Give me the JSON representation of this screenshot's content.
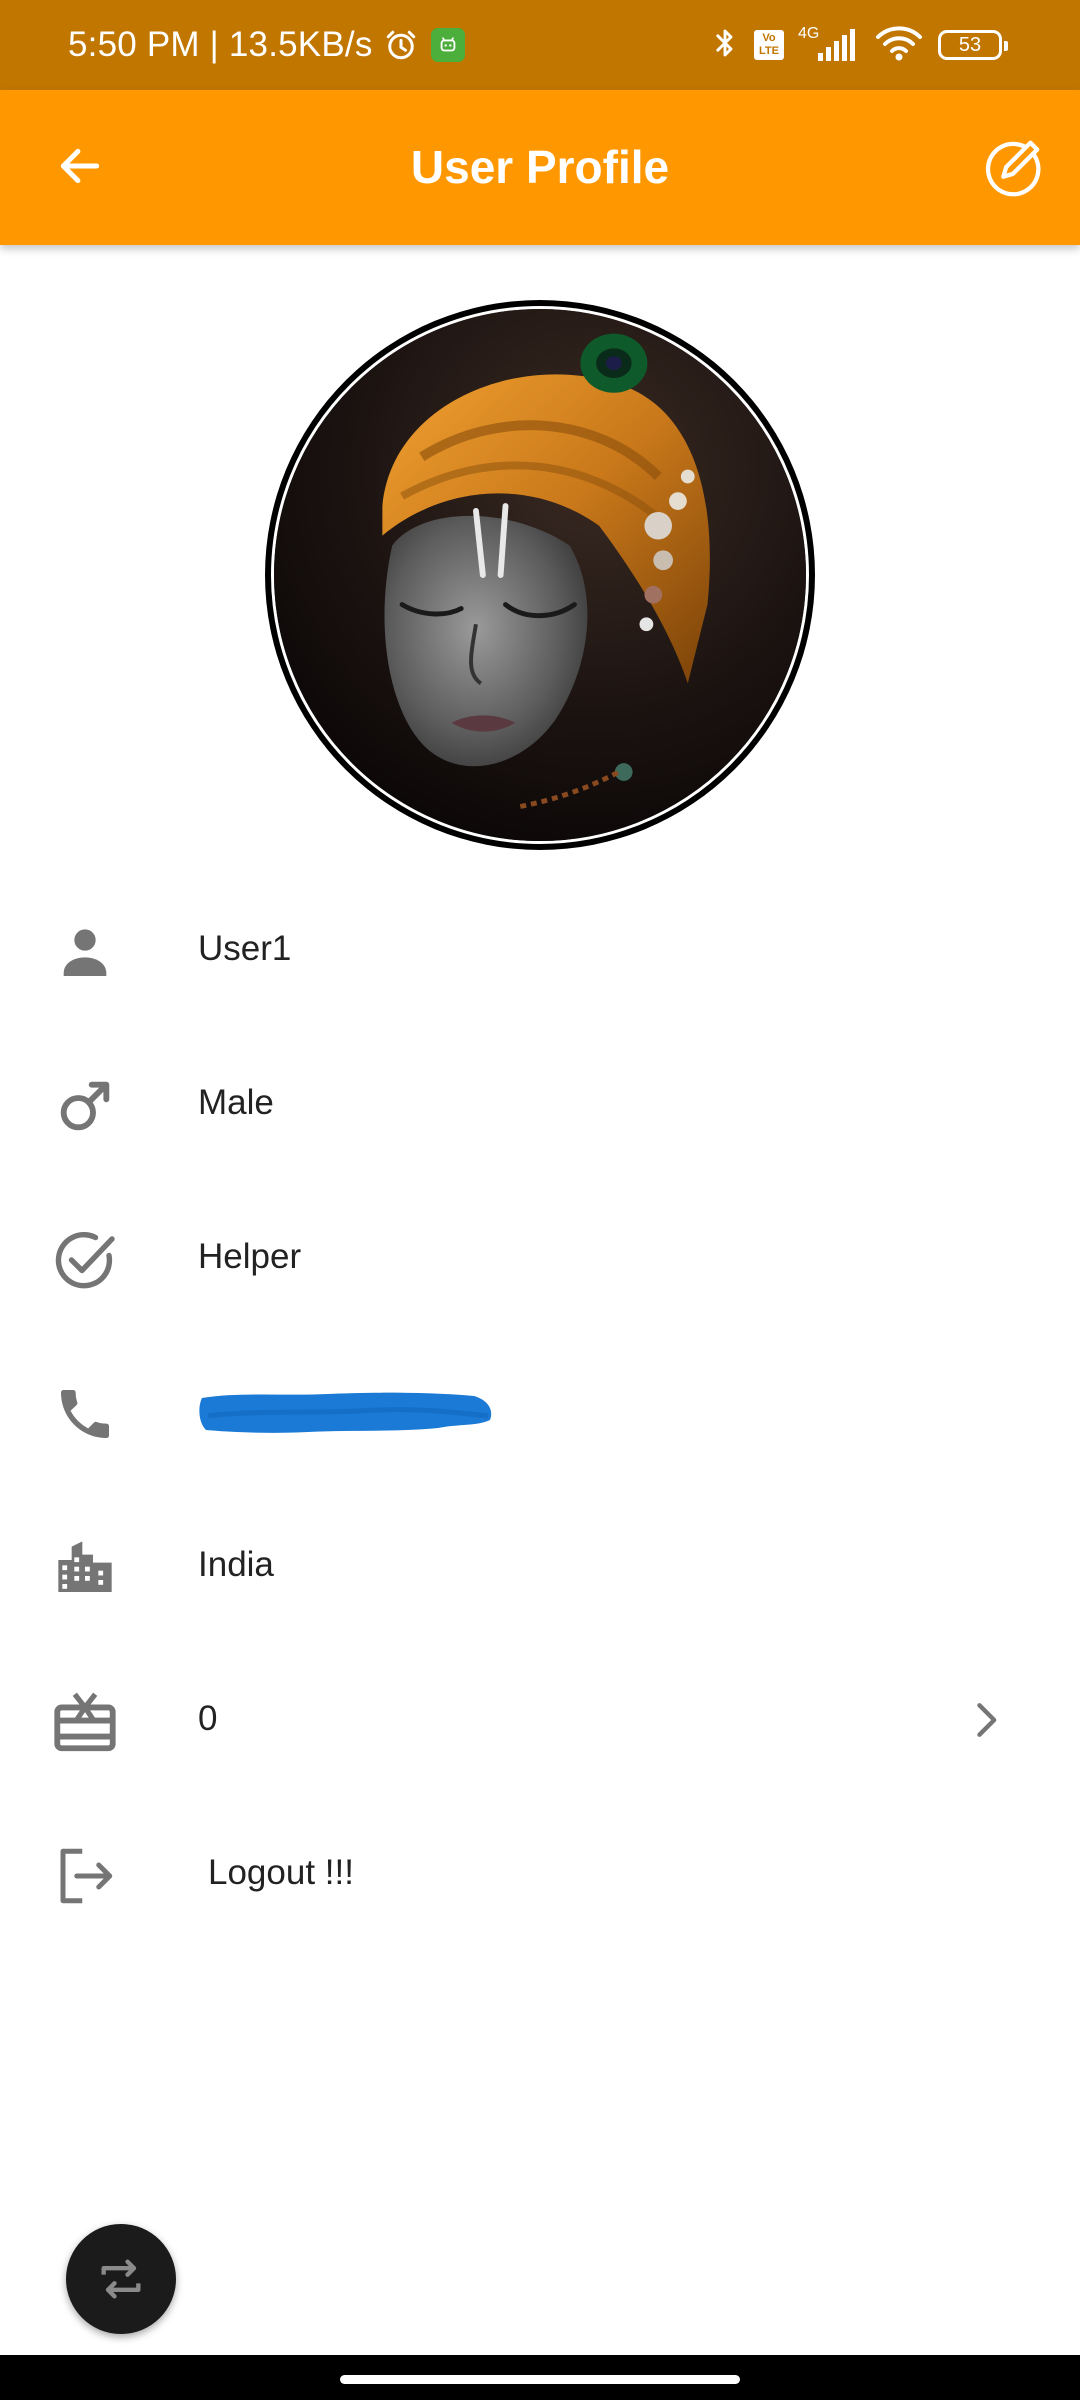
{
  "status_bar": {
    "time_speed": "5:50 PM | 13.5KB/s",
    "volte_top": "Vo",
    "volte_bottom": "LTE",
    "network": "4G",
    "battery": "53"
  },
  "app_bar": {
    "title": "User Profile"
  },
  "profile": {
    "name": "User1",
    "gender": "Male",
    "role": "Helper",
    "phone": "",
    "country": "India",
    "rewards": "0",
    "logout": "Logout !!!"
  },
  "icons": {
    "back": "arrow-left-icon",
    "edit": "edit-pencil-circle-icon",
    "name": "person-icon",
    "gender": "male-icon",
    "role": "check-circle-icon",
    "phone": "phone-icon",
    "country": "city-icon",
    "rewards": "gift-card-icon",
    "rewards_chevron": "chevron-right-icon",
    "logout": "logout-icon",
    "fab": "switch-icon"
  },
  "colors": {
    "status_bar": "#c17600",
    "app_bar": "#ff9800",
    "icon_gray": "#757575",
    "redaction_blue": "#1a7ad6",
    "fab": "#1b1b1b"
  }
}
